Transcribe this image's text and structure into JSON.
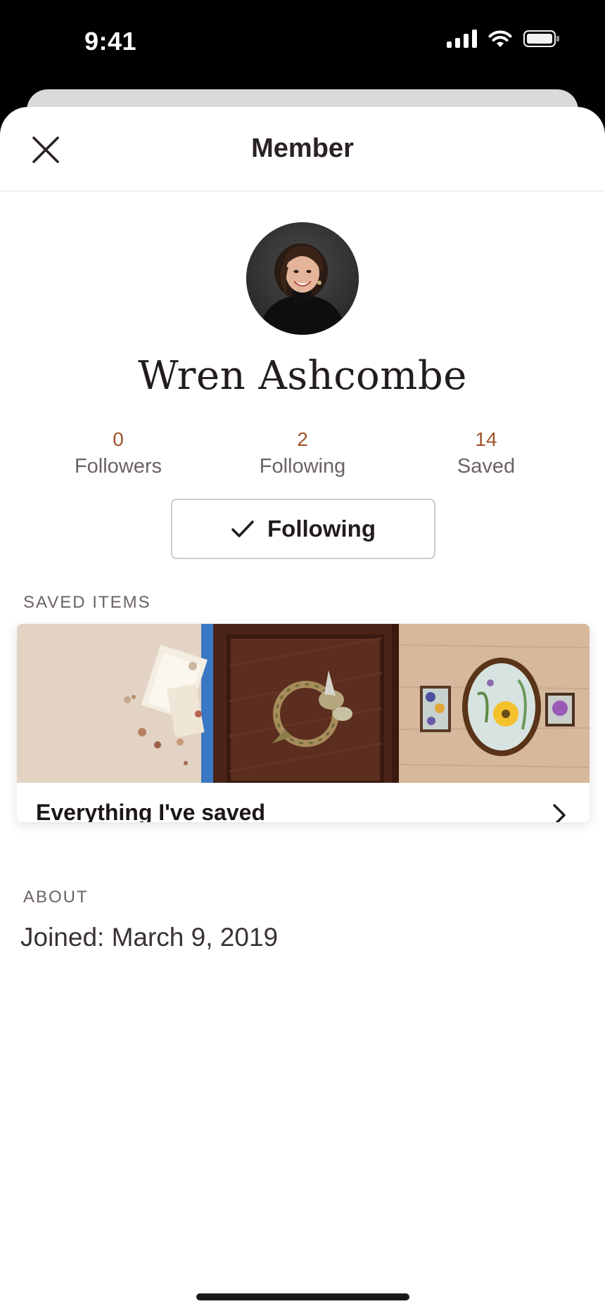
{
  "status_bar": {
    "time": "9:41"
  },
  "header": {
    "title": "Member"
  },
  "profile": {
    "name": "Wren Ashcombe",
    "stats": [
      {
        "count": "0",
        "label": "Followers"
      },
      {
        "count": "2",
        "label": "Following"
      },
      {
        "count": "14",
        "label": "Saved"
      }
    ],
    "follow_button_label": "Following"
  },
  "saved_items": {
    "section_label": "SAVED ITEMS",
    "collection_title": "Everything I've saved"
  },
  "about": {
    "section_label": "ABOUT",
    "joined": "Joined: March 9, 2019"
  },
  "colors": {
    "accent": "#a2522e",
    "text": "#221c1c",
    "muted": "#6b6361"
  }
}
